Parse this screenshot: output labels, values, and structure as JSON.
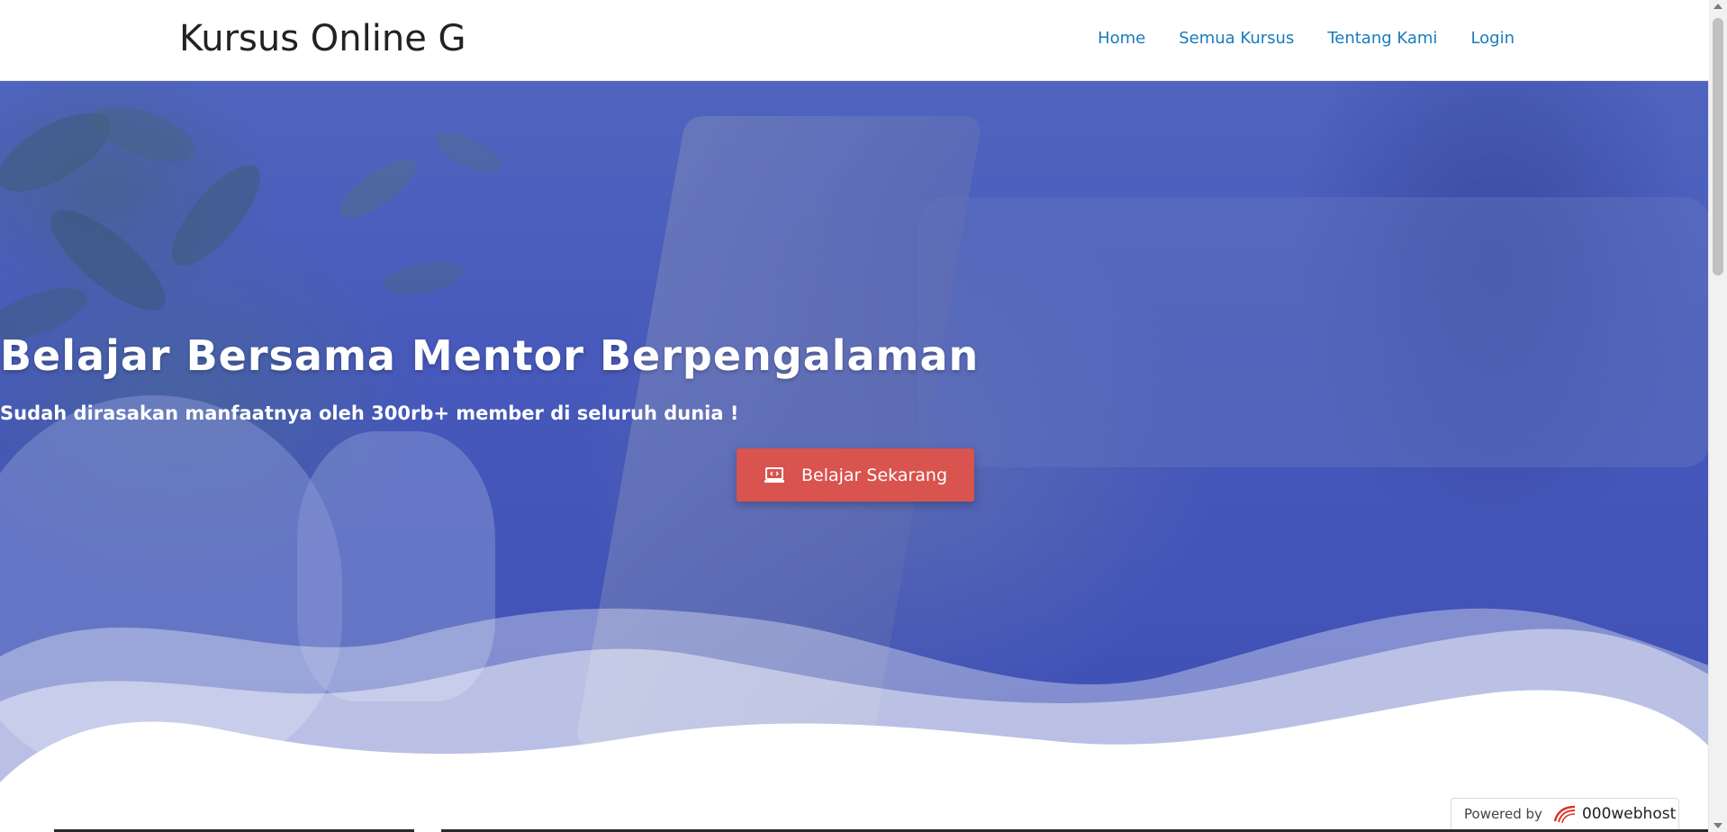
{
  "navbar": {
    "brand": "Kursus Online G",
    "links": [
      {
        "label": "Home"
      },
      {
        "label": "Semua Kursus"
      },
      {
        "label": "Tentang Kami"
      },
      {
        "label": "Login"
      }
    ]
  },
  "hero": {
    "title": "Belajar Bersama Mentor Berpengalaman",
    "subtitle": "Sudah dirasakan manfaatnya oleh 300rb+ member di seluruh dunia !",
    "cta": {
      "label": "Belajar Sekarang",
      "icon": "laptop-icon",
      "color": "#d9534f"
    },
    "overlay_color": "#4b5cb8"
  },
  "footer_badge": {
    "prefix": "Powered by",
    "brand": "000webhost",
    "icon": "000webhost-logo-icon"
  },
  "colors": {
    "nav_link": "#1a7bbf",
    "brand_text": "#222222"
  }
}
